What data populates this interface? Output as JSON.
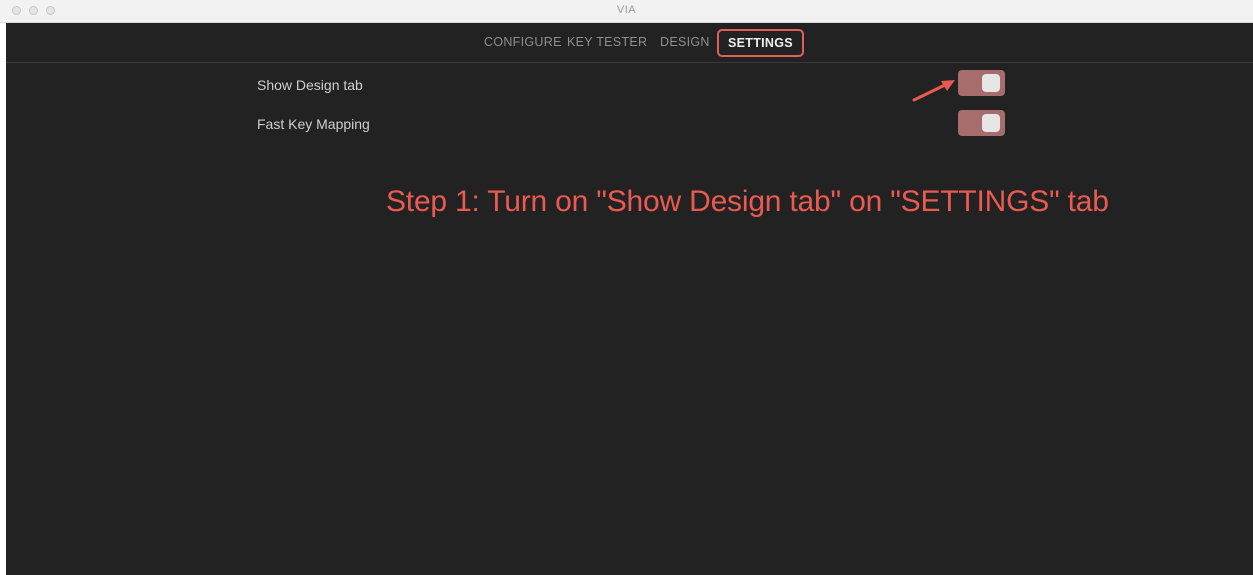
{
  "window": {
    "title": "VIA"
  },
  "menu": {
    "tabs": [
      {
        "label": "CONFIGURE",
        "selected": false
      },
      {
        "label": "KEY TESTER",
        "selected": false
      },
      {
        "label": "DESIGN",
        "selected": false
      },
      {
        "label": "SETTINGS",
        "selected": true
      }
    ]
  },
  "settings": [
    {
      "label": "Show Design tab",
      "enabled": true
    },
    {
      "label": "Fast Key Mapping",
      "enabled": true
    }
  ],
  "annotation": {
    "text": "Step 1: Turn on \"Show Design tab\" on \"SETTINGS\" tab",
    "color": "#ea5a50"
  },
  "colors": {
    "background": "#222222",
    "toggle_on": "#a76c6c",
    "highlight_border": "#e25f55"
  },
  "icons": {
    "annotation_arrow": "arrow-icon"
  }
}
